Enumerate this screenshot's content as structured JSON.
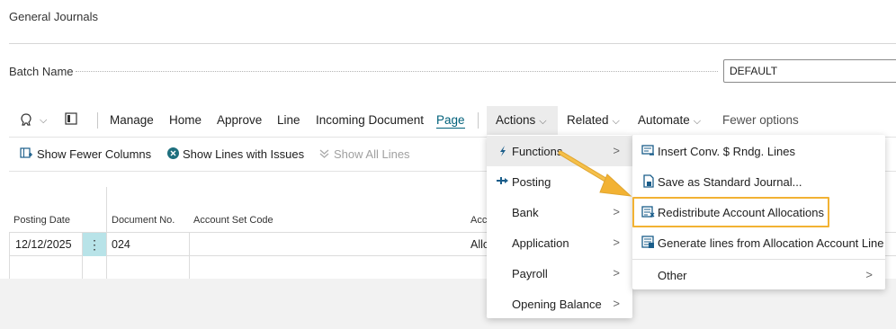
{
  "page": {
    "title": "General Journals"
  },
  "batch": {
    "label": "Batch Name",
    "value": "DEFAULT"
  },
  "toolbar": {
    "manage": "Manage",
    "home": "Home",
    "approve": "Approve",
    "line": "Line",
    "incoming_document": "Incoming Document",
    "page": "Page",
    "actions": "Actions",
    "related": "Related",
    "automate": "Automate",
    "fewer_options": "Fewer options"
  },
  "subbar": {
    "show_fewer_columns": "Show Fewer Columns",
    "show_lines_with_issues": "Show Lines with Issues",
    "show_all_lines": "Show All Lines"
  },
  "grid": {
    "columns": [
      "Posting Date",
      "Document No.",
      "Account Set Code",
      "Acco"
    ],
    "rows": [
      {
        "posting_date": "12/12/2025",
        "document_no": "024",
        "account_set_code": "",
        "account": "Allo"
      }
    ]
  },
  "actions_menu": [
    {
      "label": "Functions",
      "icon": "function-icon",
      "submenu": true
    },
    {
      "label": "Posting",
      "icon": "posting-icon",
      "submenu": false
    },
    {
      "label": "Bank",
      "submenu": true
    },
    {
      "label": "Application",
      "submenu": true
    },
    {
      "label": "Payroll",
      "submenu": true
    },
    {
      "label": "Opening Balance",
      "submenu": true
    }
  ],
  "functions_menu": [
    {
      "label": "Insert Conv. $ Rndg. Lines",
      "icon": "insert-lines-icon"
    },
    {
      "label": "Save as Standard Journal...",
      "icon": "save-journal-icon"
    },
    {
      "label": "Redistribute Account Allocations",
      "icon": "redistribute-icon",
      "highlighted": true
    },
    {
      "label": "Generate lines from Allocation Account Line",
      "icon": "generate-lines-icon"
    },
    {
      "label": "Other",
      "submenu": true
    }
  ],
  "colors": {
    "accent": "#00607a",
    "highlight": "#f2b233",
    "arrow": "#f2b233"
  }
}
